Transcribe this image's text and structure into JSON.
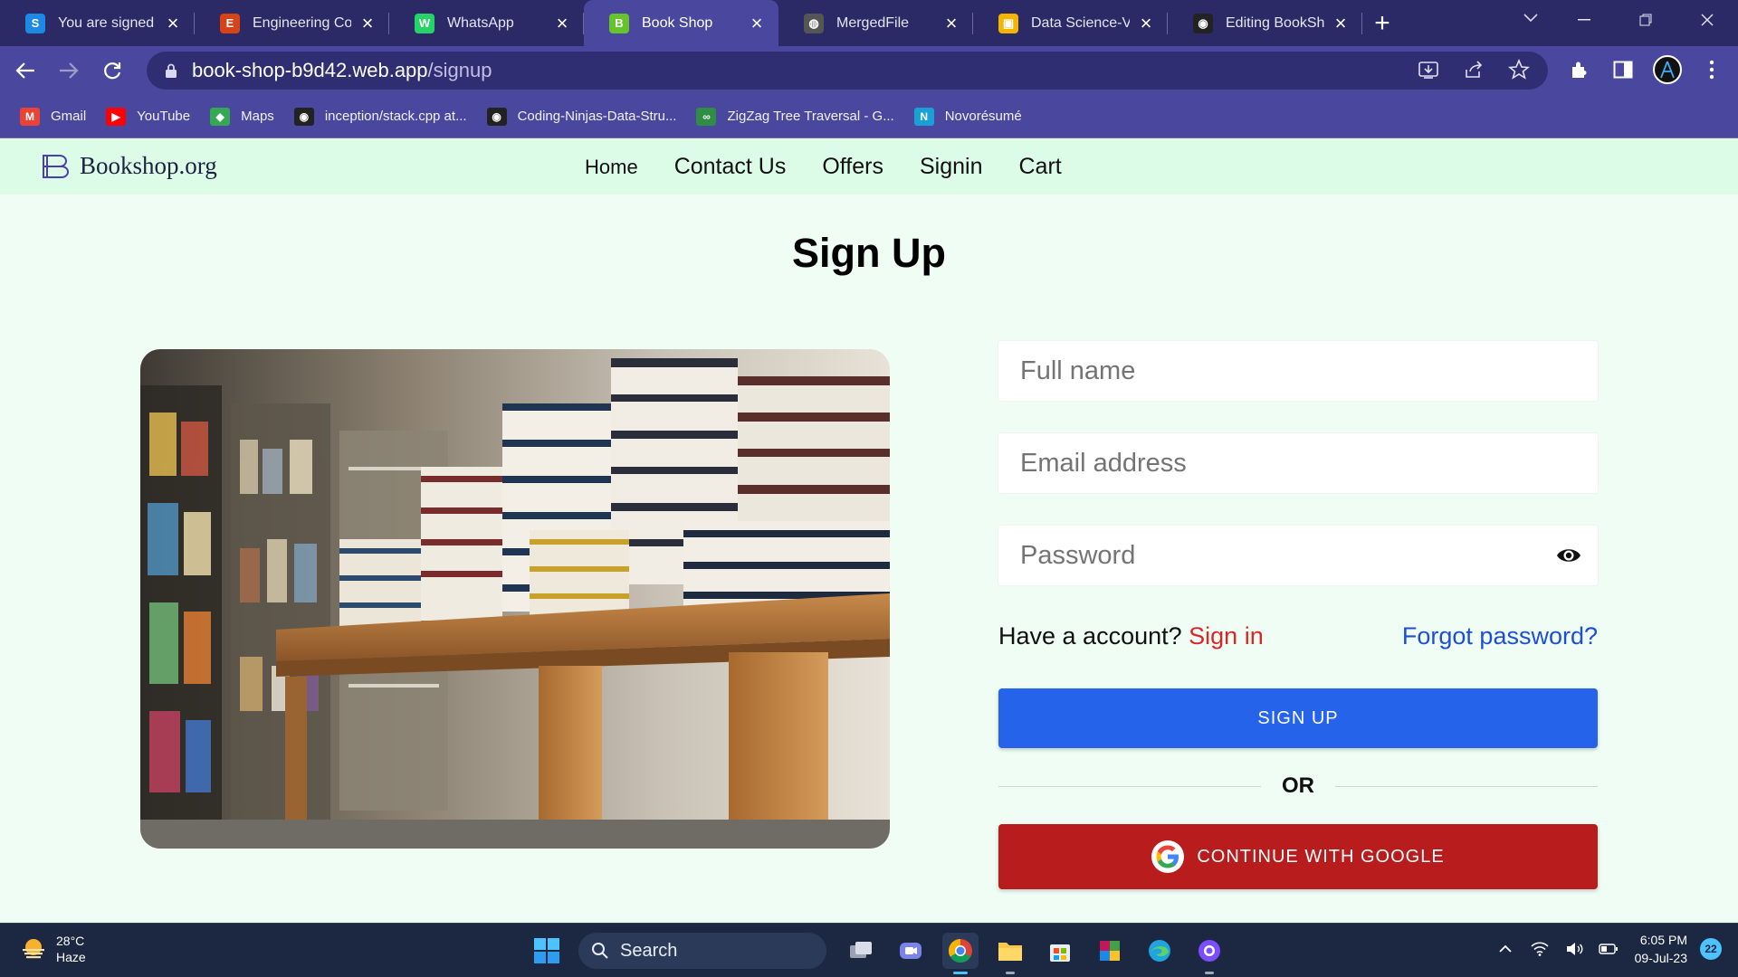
{
  "browser": {
    "tabs": [
      {
        "title": "You are signed in",
        "icon": "s-logo-icon",
        "color": "#1e88e5",
        "glyph": "S"
      },
      {
        "title": "Engineering Colle",
        "icon": "college-logo-icon",
        "color": "#d84315",
        "glyph": "E"
      },
      {
        "title": "WhatsApp",
        "icon": "whatsapp-icon",
        "color": "#25d366",
        "glyph": "W"
      },
      {
        "title": "Book Shop",
        "icon": "book-shop-favicon",
        "color": "#65c32b",
        "glyph": "B",
        "active": true
      },
      {
        "title": "MergedFile",
        "icon": "globe-icon",
        "color": "#555",
        "glyph": "◍"
      },
      {
        "title": "Data Science-V Se",
        "icon": "slides-icon",
        "color": "#f4b400",
        "glyph": "▣"
      },
      {
        "title": "Editing BookShop",
        "icon": "github-icon",
        "color": "#222",
        "glyph": "◉"
      }
    ],
    "url_host": "book-shop-b9d42.web.app",
    "url_path": "/signup",
    "bookmarks": [
      {
        "label": "Gmail",
        "icon": "gmail-icon",
        "color": "#ea4335",
        "glyph": "M"
      },
      {
        "label": "YouTube",
        "icon": "youtube-icon",
        "color": "#ff0000",
        "glyph": "▶"
      },
      {
        "label": "Maps",
        "icon": "maps-icon",
        "color": "#34a853",
        "glyph": "◆"
      },
      {
        "label": "inception/stack.cpp at...",
        "icon": "github-icon",
        "color": "#222",
        "glyph": "◉"
      },
      {
        "label": "Coding-Ninjas-Data-Stru...",
        "icon": "github-icon",
        "color": "#222",
        "glyph": "◉"
      },
      {
        "label": "ZigZag Tree Traversal - G...",
        "icon": "gfg-icon",
        "color": "#2f8d46",
        "glyph": "∞"
      },
      {
        "label": "Novorésumé",
        "icon": "novoresume-icon",
        "color": "#1a9fd6",
        "glyph": "N"
      }
    ]
  },
  "site": {
    "brand": "Bookshop.org",
    "nav": [
      "Home",
      "Contact Us",
      "Offers",
      "Signin",
      "Cart"
    ],
    "heading": "Sign Up",
    "form": {
      "fullname_placeholder": "Full name",
      "email_placeholder": "Email address",
      "password_placeholder": "Password",
      "have_account": "Have a account?",
      "signin_link": "Sign in",
      "forgot_link": "Forgot password?",
      "signup_button": "SIGN UP",
      "or": "OR",
      "google_button": "CONTINUE WITH GOOGLE"
    },
    "colors": {
      "signup": "#2563eb",
      "google": "#b91c1c",
      "signin_link": "#dc2626",
      "forgot_link": "#1d4ed8",
      "nav_bg": "#dcfce7",
      "page_bg": "#f0fdf4"
    }
  },
  "taskbar": {
    "weather_temp": "28°C",
    "weather_desc": "Haze",
    "search_label": "Search",
    "time": "6:05 PM",
    "date": "09-Jul-23",
    "notifications": "22"
  }
}
